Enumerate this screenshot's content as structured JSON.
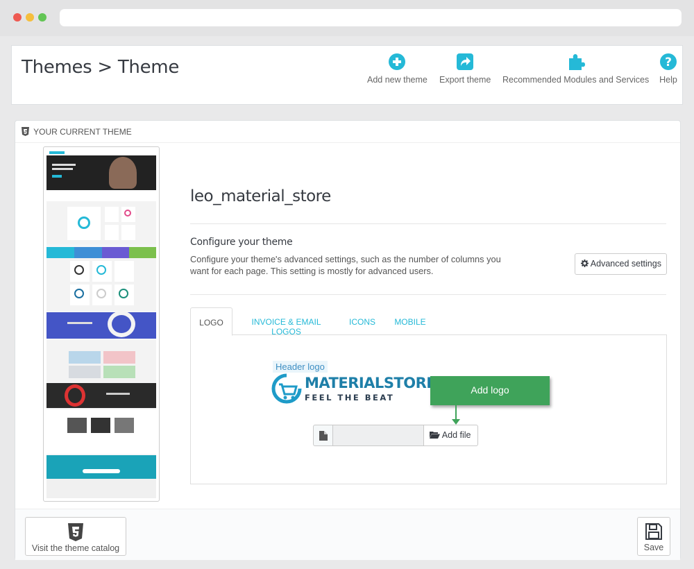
{
  "header": {
    "title": "Themes > Theme",
    "toolbar": [
      {
        "label": "Add new theme",
        "icon": "add-circle-icon"
      },
      {
        "label": "Export theme",
        "icon": "export-share-icon"
      },
      {
        "label": "Recommended Modules and Services",
        "icon": "puzzle-icon"
      },
      {
        "label": "Help",
        "icon": "question-circle-icon"
      }
    ]
  },
  "panel": {
    "heading": "YOUR CURRENT THEME",
    "theme_name": "leo_material_store",
    "configure_title": "Configure your theme",
    "configure_desc": "Configure your theme's advanced settings, such as the number of columns you want for each page. This setting is mostly for advanced users.",
    "advanced_button": "Advanced settings",
    "tabs": [
      "LOGO",
      "INVOICE & EMAIL LOGOS",
      "ICONS",
      "MOBILE"
    ],
    "active_tab": "LOGO",
    "logo": {
      "caption": "Header logo",
      "wordmark_a": "MATERIAL",
      "wordmark_b": "STORE",
      "tagline": "FEEL THE BEAT",
      "callout": "Add logo",
      "add_file_button": "Add file"
    },
    "footer": {
      "catalog_button": "Visit the theme catalog",
      "save_button": "Save"
    }
  },
  "colors": {
    "accent": "#25b9d7",
    "callout": "#3fa35a",
    "title": "#363a41"
  }
}
